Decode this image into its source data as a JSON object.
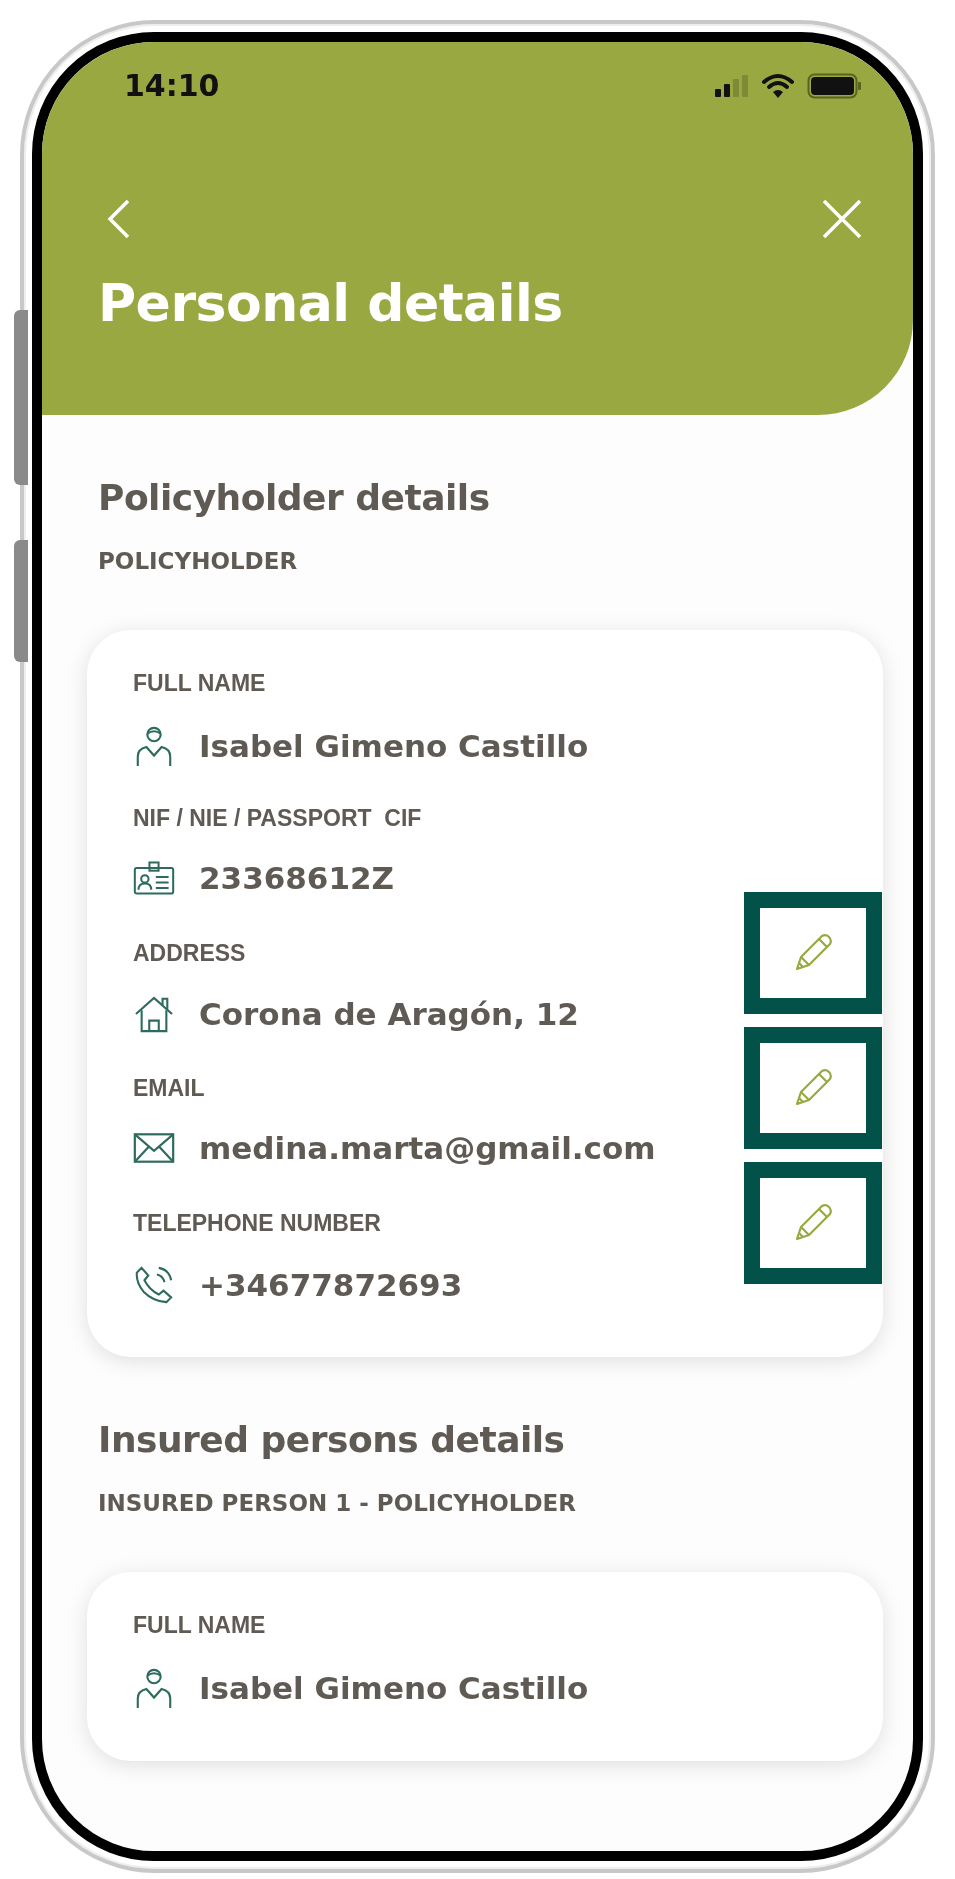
{
  "status_bar": {
    "time": "14:10"
  },
  "header": {
    "title": "Personal details"
  },
  "sections": [
    {
      "title": "Policyholder details",
      "subtitle": "POLICYHOLDER",
      "fields": [
        {
          "kind": "person",
          "label": "FULL NAME",
          "value": "Isabel Gimeno Castillo",
          "editable": false
        },
        {
          "kind": "id",
          "label": "NIF / NIE / PASSPORT  CIF",
          "value": "23368612Z",
          "editable": false
        },
        {
          "kind": "address",
          "label": "ADDRESS",
          "value": "Corona de Aragón, 12",
          "editable": true
        },
        {
          "kind": "email",
          "label": "EMAIL",
          "value": "medina.marta@gmail.com",
          "editable": true
        },
        {
          "kind": "phone",
          "label": "TELEPHONE NUMBER",
          "value": "+34677872693",
          "editable": true
        }
      ]
    },
    {
      "title": "Insured persons details",
      "subtitle": "INSURED PERSON 1 - POLICYHOLDER",
      "fields": [
        {
          "kind": "person",
          "label": "FULL NAME",
          "value": "Isabel Gimeno Castillo",
          "editable": false
        }
      ]
    }
  ]
}
